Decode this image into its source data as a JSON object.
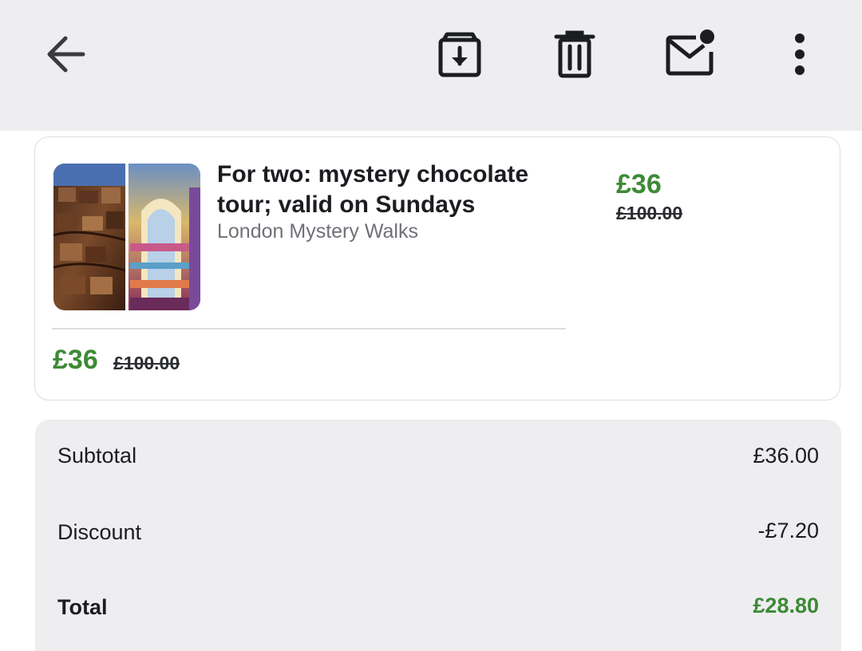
{
  "toolbar": {
    "back_icon": "arrow-left-icon",
    "archive_icon": "archive-icon",
    "delete_icon": "trash-icon",
    "mark_unread_icon": "mail-unread-icon",
    "more_icon": "more-vertical-icon"
  },
  "deal": {
    "title": "For two: mystery chocolate tour; valid on Sundays",
    "merchant": "London Mystery Walks",
    "price": "£36",
    "original_price": "£100.00"
  },
  "summary": {
    "subtotal_label": "Subtotal",
    "subtotal_value": "£36.00",
    "discount_label": "Discount",
    "discount_value": "-£7.20",
    "total_label": "Total",
    "total_value": "£28.80"
  },
  "colors": {
    "toolbar_bg": "#eeeef0",
    "price_green": "#3d8a36",
    "text_dark": "#1b1d21",
    "text_muted": "#6f7177"
  }
}
